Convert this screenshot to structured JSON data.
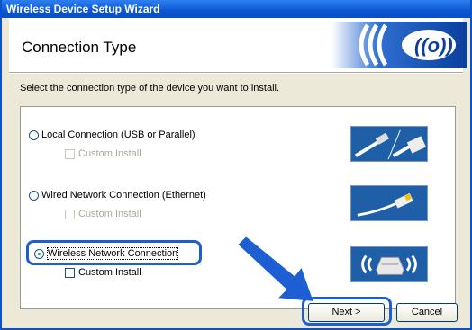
{
  "window": {
    "title": "Wireless Device Setup Wizard"
  },
  "header": {
    "title": "Connection Type"
  },
  "instruction": "Select the connection type of the device you want to install.",
  "options": [
    {
      "label": "Local Connection (USB or Parallel)",
      "selected": false,
      "custom_install": "Custom Install",
      "custom_enabled": false
    },
    {
      "label": "Wired Network Connection (Ethernet)",
      "selected": false,
      "custom_install": "Custom Install",
      "custom_enabled": false
    },
    {
      "label": "Wireless Network Connection",
      "selected": true,
      "custom_install": "Custom Install",
      "custom_enabled": true
    }
  ],
  "buttons": {
    "next": "Next >",
    "cancel": "Cancel"
  },
  "colors": {
    "titlebar": "#0b57d4",
    "highlight": "#1d5fd3",
    "image_bg": "#1f5fa7"
  }
}
